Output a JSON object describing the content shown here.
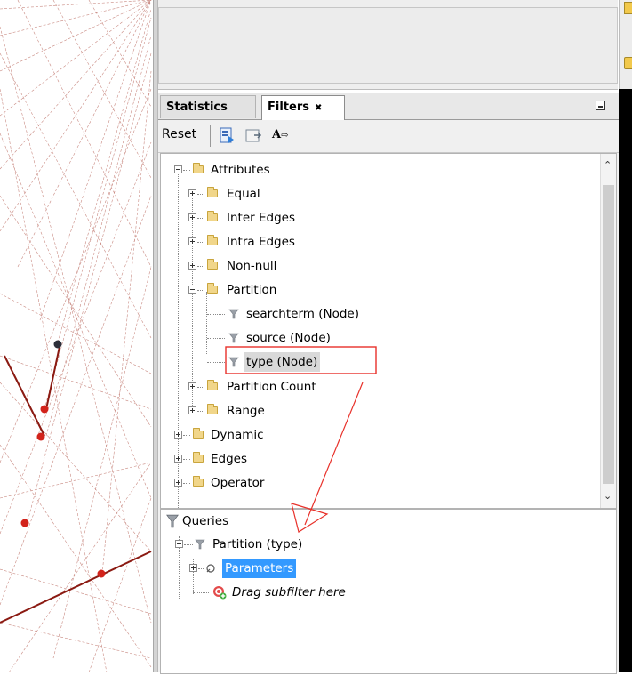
{
  "tabs": {
    "statistics": "Statistics",
    "filters": "Filters",
    "filters_close": "✖"
  },
  "toolbar": {
    "reset": "Reset",
    "font_icon_text": "A"
  },
  "tree": {
    "attributes": "Attributes",
    "equal": "Equal",
    "inter_edges": "Inter Edges",
    "intra_edges": "Intra Edges",
    "non_null": "Non-null",
    "partition": "Partition",
    "searchterm": "searchterm (Node)",
    "source": "source (Node)",
    "type": "type (Node)",
    "partition_count": "Partition Count",
    "range": "Range",
    "dynamic": "Dynamic",
    "edges": "Edges",
    "operator": "Operator"
  },
  "queries": {
    "title": "Queries",
    "partition_type": "Partition (type)",
    "parameters": "Parameters",
    "drag_subfilter": "Drag subfilter here"
  },
  "colors": {
    "annotation_red": "#e8312a",
    "selection_blue": "#3399ff",
    "edge_dark_red": "#8b1a12"
  },
  "icons": {
    "filter": "funnel-icon",
    "folder": "folder-icon",
    "target": "target-add-icon",
    "parameters": "wrench-icon"
  }
}
